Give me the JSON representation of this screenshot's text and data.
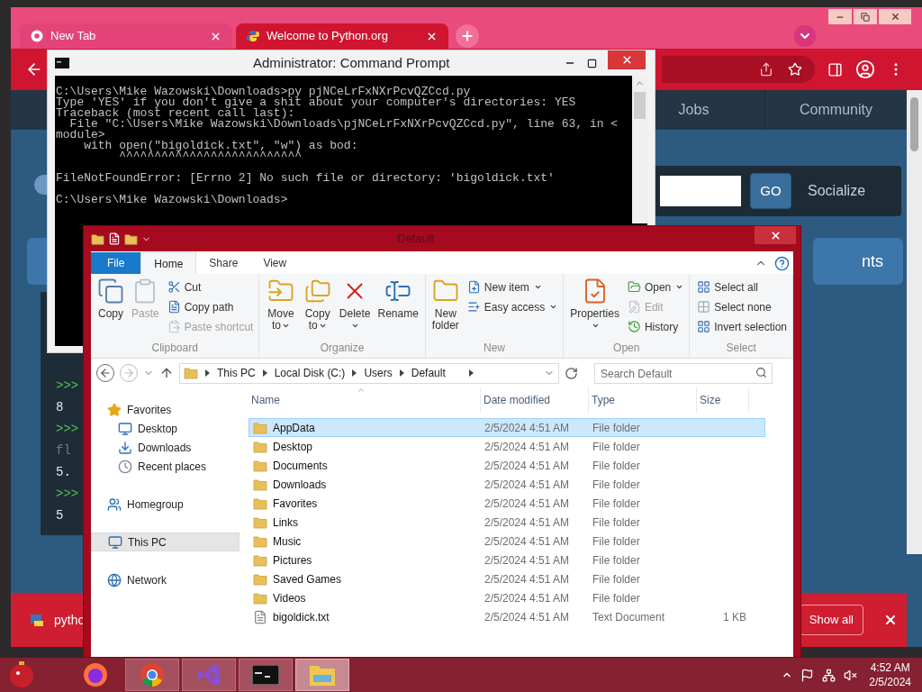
{
  "browser": {
    "tabs": [
      {
        "title": "New Tab",
        "selected": false
      },
      {
        "title": "Welcome to Python.org",
        "selected": true
      }
    ],
    "site": {
      "nav": [
        {
          "label": "Jobs"
        },
        {
          "label": "Community"
        }
      ],
      "search_button": "GO",
      "socialize": "Socialize",
      "section_button": "nts",
      "console_lines": [
        {
          "kind": "prompt",
          "text": ">>>"
        },
        {
          "kind": "output",
          "text": "8"
        },
        {
          "kind": "prompt",
          "text": ">>>"
        },
        {
          "kind": "comment",
          "text": "fl"
        },
        {
          "kind": "output",
          "text": "5."
        },
        {
          "kind": "prompt",
          "text": ">>>"
        },
        {
          "kind": "output",
          "text": "5"
        }
      ]
    },
    "downloads": {
      "file": "pytho",
      "show_all": "Show all"
    }
  },
  "cmd": {
    "title": "Administrator: Command Prompt",
    "blocks": [
      [
        "C:\\Users\\Mike Wazowski\\Downloads>py pjNCeLrFxNXrPcvQZCcd.py",
        "Type 'YES' if you don't give a shit about your computer's directories: YES",
        "Traceback (most recent call last):",
        "  File \"C:\\Users\\Mike Wazowski\\Downloads\\pjNCeLrFxNXrPcvQZCcd.py\", line 63, in <",
        "module>",
        "    with open(\"bigoldick.txt\", \"w\") as bod:",
        "         ^^^^^^^^^^^^^^^^^^^^^^^^^^"
      ],
      [
        "FileNotFoundError: [Errno 2] No such file or directory: 'bigoldick.txt'"
      ],
      [
        "C:\\Users\\Mike Wazowski\\Downloads>"
      ]
    ]
  },
  "explorer": {
    "title": "Default",
    "ribbon_tabs": [
      {
        "label": "File",
        "kind": "file",
        "selected": false
      },
      {
        "label": "Home",
        "kind": "tab",
        "selected": true
      },
      {
        "label": "Share",
        "kind": "tab",
        "selected": false
      },
      {
        "label": "View",
        "kind": "tab",
        "selected": false
      }
    ],
    "groups": [
      {
        "label": "Clipboard",
        "items": [
          {
            "label": "Copy",
            "kind": "large",
            "disabled": false,
            "dropdown": false
          },
          {
            "label": "Paste",
            "kind": "large",
            "disabled": true,
            "dropdown": false
          },
          {
            "label": "Cut",
            "kind": "small",
            "disabled": false,
            "dropdown": false
          },
          {
            "label": "Copy path",
            "kind": "small",
            "disabled": false,
            "dropdown": false
          },
          {
            "label": "Paste shortcut",
            "kind": "small",
            "disabled": true,
            "dropdown": false
          }
        ]
      },
      {
        "label": "Organize",
        "items": [
          {
            "label": "Move to",
            "kind": "large",
            "disabled": false,
            "dropdown": true
          },
          {
            "label": "Copy to",
            "kind": "large",
            "disabled": false,
            "dropdown": true
          },
          {
            "label": "Delete",
            "kind": "large",
            "disabled": false,
            "dropdown": true
          },
          {
            "label": "Rename",
            "kind": "large",
            "disabled": false,
            "dropdown": false
          }
        ]
      },
      {
        "label": "New",
        "items": [
          {
            "label": "New folder",
            "kind": "large",
            "disabled": false,
            "dropdown": false
          },
          {
            "label": "New item",
            "kind": "small",
            "disabled": false,
            "dropdown": true
          },
          {
            "label": "Easy access",
            "kind": "small",
            "disabled": false,
            "dropdown": true
          }
        ]
      },
      {
        "label": "Open",
        "items": [
          {
            "label": "Properties",
            "kind": "large",
            "disabled": false,
            "dropdown": true
          },
          {
            "label": "Open",
            "kind": "small",
            "disabled": false,
            "dropdown": true
          },
          {
            "label": "Edit",
            "kind": "small",
            "disabled": true,
            "dropdown": false
          },
          {
            "label": "History",
            "kind": "small",
            "disabled": false,
            "dropdown": false
          }
        ]
      },
      {
        "label": "Select",
        "items": [
          {
            "label": "Select all",
            "kind": "small",
            "disabled": false,
            "dropdown": false
          },
          {
            "label": "Select none",
            "kind": "small",
            "disabled": false,
            "dropdown": false
          },
          {
            "label": "Invert selection",
            "kind": "small",
            "disabled": false,
            "dropdown": false
          }
        ]
      }
    ],
    "address": [
      "This PC",
      "Local Disk (C:)",
      "Users",
      "Default"
    ],
    "search": {
      "placeholder": "Search Default"
    },
    "nav": [
      {
        "label": "Favorites",
        "selected": false,
        "children": [
          {
            "label": "Desktop",
            "selected": false
          },
          {
            "label": "Downloads",
            "selected": false
          },
          {
            "label": "Recent places",
            "selected": false
          }
        ]
      },
      {
        "label": "Homegroup",
        "selected": false
      },
      {
        "label": "This PC",
        "selected": true
      },
      {
        "label": "Network",
        "selected": false
      }
    ],
    "columns": [
      "Name",
      "Date modified",
      "Type",
      "Size"
    ],
    "rows": [
      {
        "name": "AppData",
        "date": "2/5/2024 4:51 AM",
        "type": "File folder",
        "kind": "folder",
        "selected": true
      },
      {
        "name": "Desktop",
        "date": "2/5/2024 4:51 AM",
        "type": "File folder",
        "kind": "folder",
        "selected": false
      },
      {
        "name": "Documents",
        "date": "2/5/2024 4:51 AM",
        "type": "File folder",
        "kind": "folder",
        "selected": false
      },
      {
        "name": "Downloads",
        "date": "2/5/2024 4:51 AM",
        "type": "File folder",
        "kind": "folder",
        "selected": false
      },
      {
        "name": "Favorites",
        "date": "2/5/2024 4:51 AM",
        "type": "File folder",
        "kind": "folder",
        "selected": false
      },
      {
        "name": "Links",
        "date": "2/5/2024 4:51 AM",
        "type": "File folder",
        "kind": "folder",
        "selected": false
      },
      {
        "name": "Music",
        "date": "2/5/2024 4:51 AM",
        "type": "File folder",
        "kind": "folder",
        "selected": false
      },
      {
        "name": "Pictures",
        "date": "2/5/2024 4:51 AM",
        "type": "File folder",
        "kind": "folder",
        "selected": false
      },
      {
        "name": "Saved Games",
        "date": "2/5/2024 4:51 AM",
        "type": "File folder",
        "kind": "folder",
        "selected": false
      },
      {
        "name": "Videos",
        "date": "2/5/2024 4:51 AM",
        "type": "File folder",
        "kind": "folder",
        "selected": false
      },
      {
        "name": "bigoldick.txt",
        "date": "2/5/2024 4:51 AM",
        "type": "Text Document",
        "size": "1 KB",
        "kind": "text",
        "selected": false
      }
    ]
  },
  "taskbar": {
    "apps": [
      {
        "kind": "firefox",
        "running": false,
        "selected": false
      },
      {
        "kind": "chrome",
        "running": true,
        "selected": false
      },
      {
        "kind": "visual-studio",
        "running": true,
        "selected": false
      },
      {
        "kind": "cmd",
        "running": true,
        "selected": false
      },
      {
        "kind": "explorer",
        "running": true,
        "selected": true
      }
    ],
    "clock": {
      "time": "4:52 AM",
      "date": "2/5/2024"
    }
  }
}
